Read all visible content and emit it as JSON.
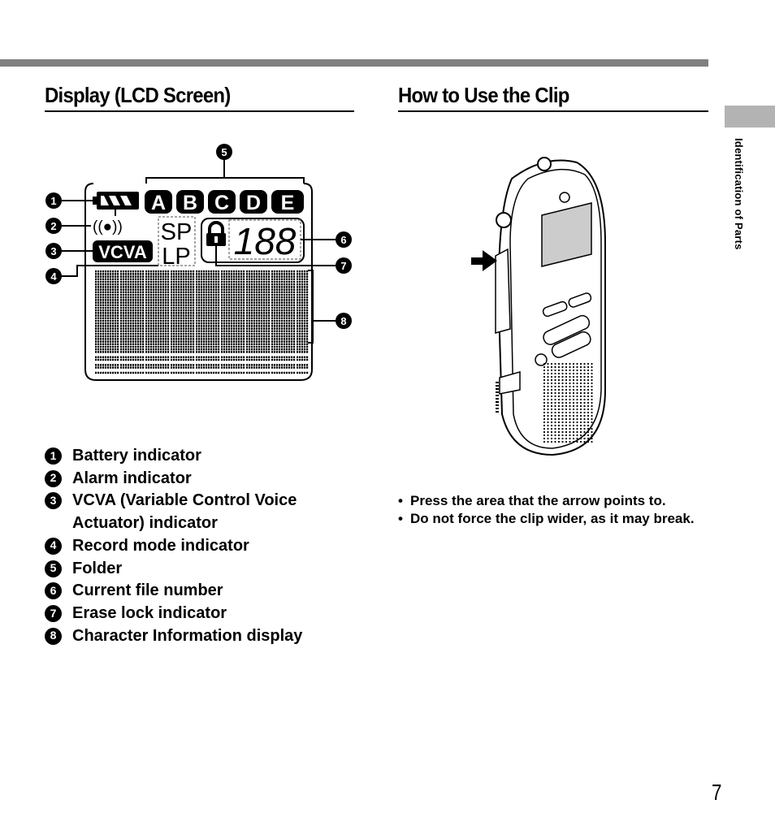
{
  "side_tab": {
    "label": "Identification of Parts"
  },
  "left_section": {
    "title": "Display (LCD Screen)",
    "lcd": {
      "folders": [
        "A",
        "B",
        "C",
        "D",
        "E"
      ],
      "record_modes": [
        "SP",
        "LP"
      ],
      "vcva_label": "VCVA",
      "alarm_symbol": "((●))",
      "file_number": "188",
      "callouts": [
        "1",
        "2",
        "3",
        "4",
        "5",
        "6",
        "7",
        "8"
      ]
    },
    "legend": [
      {
        "num": "1",
        "text": "Battery indicator"
      },
      {
        "num": "2",
        "text": "Alarm indicator"
      },
      {
        "num": "3",
        "text": "VCVA (Variable Control Voice Actuator) indicator"
      },
      {
        "num": "4",
        "text": "Record mode indicator"
      },
      {
        "num": "5",
        "text": "Folder"
      },
      {
        "num": "6",
        "text": "Current file number"
      },
      {
        "num": "7",
        "text": "Erase lock indicator"
      },
      {
        "num": "8",
        "text": "Character Information display"
      }
    ]
  },
  "right_section": {
    "title": "How to Use the Clip",
    "bullets": [
      "Press the area that the arrow points to.",
      "Do not force the clip wider, as it may break."
    ]
  },
  "page_number": "7"
}
